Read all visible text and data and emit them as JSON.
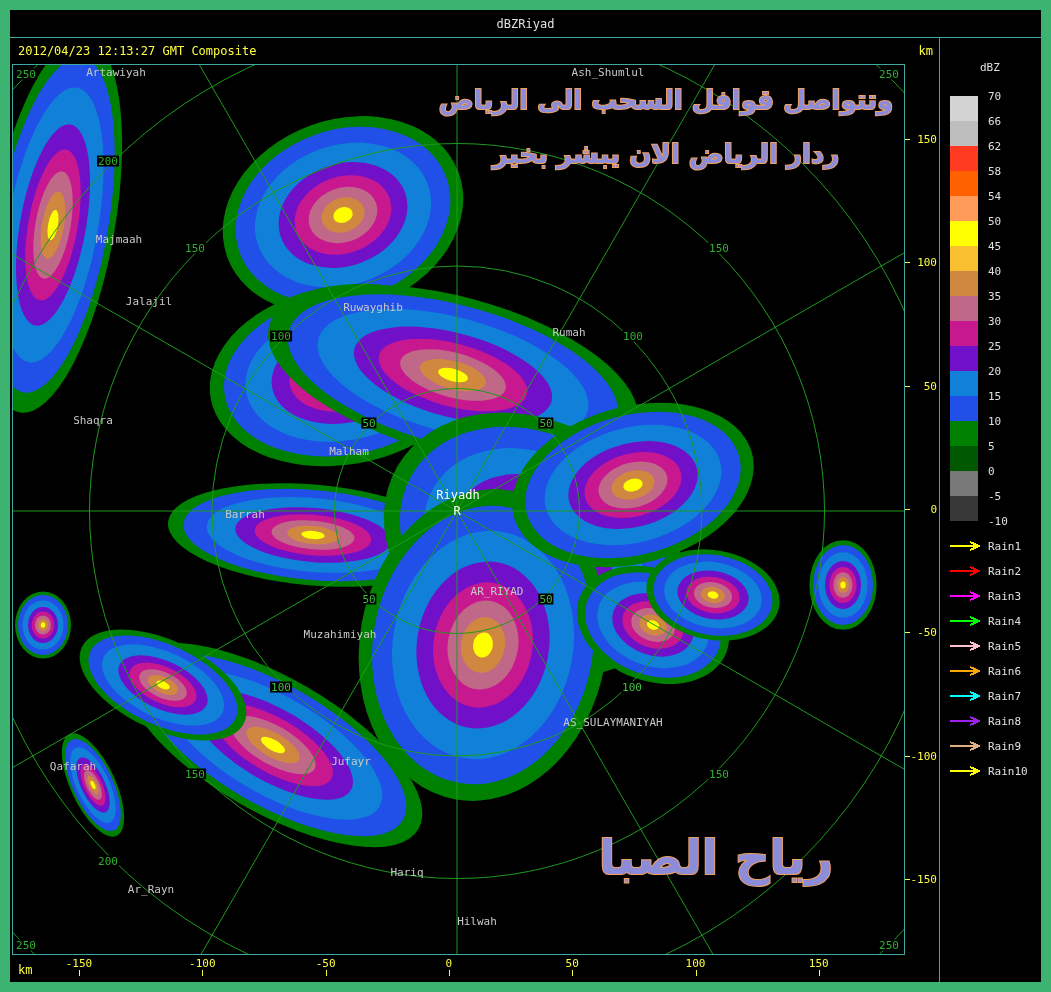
{
  "window": {
    "title": "dBZRiyad"
  },
  "header": {
    "timestamp": "2012/04/23 12:13:27 GMT Composite",
    "unit": "km"
  },
  "map": {
    "range_labels": [
      {
        "label": "250",
        "kind": "plain"
      },
      {
        "label": "250",
        "kind": "plain"
      },
      {
        "label": "200",
        "kind": "plain"
      },
      {
        "label": "150",
        "kind": "plain"
      },
      {
        "label": "150",
        "kind": "plain"
      },
      {
        "label": "100",
        "kind": "plain"
      },
      {
        "label": "100",
        "kind": "plain"
      },
      {
        "label": "50",
        "kind": "boxed"
      },
      {
        "label": "50",
        "kind": "boxed"
      },
      {
        "label": "50",
        "kind": "boxed"
      },
      {
        "label": "50",
        "kind": "boxed"
      },
      {
        "label": "100",
        "kind": "boxed"
      },
      {
        "label": "100",
        "kind": "boxed"
      },
      {
        "label": "150",
        "kind": "plain"
      },
      {
        "label": "150",
        "kind": "plain"
      },
      {
        "label": "200",
        "kind": "plain"
      },
      {
        "label": "250",
        "kind": "plain"
      },
      {
        "label": "250",
        "kind": "plain"
      }
    ],
    "places": [
      {
        "label": "Artawiyah",
        "kind": "town"
      },
      {
        "label": "Ash_Shumlul",
        "kind": "town"
      },
      {
        "label": "Majmaah",
        "kind": "town"
      },
      {
        "label": "Jalajil",
        "kind": "town"
      },
      {
        "label": "Ruwayghib",
        "kind": "town"
      },
      {
        "label": "Rumah",
        "kind": "town"
      },
      {
        "label": "Shaqra",
        "kind": "town"
      },
      {
        "label": "Malham",
        "kind": "town"
      },
      {
        "label": "Barrah",
        "kind": "town"
      },
      {
        "label": "Riyadh",
        "kind": "radar"
      },
      {
        "label": "R",
        "kind": "radar"
      },
      {
        "label": "AR_RIYAD",
        "kind": "town"
      },
      {
        "label": "Muzahimiyah",
        "kind": "town"
      },
      {
        "label": "AS_SULAYMANIYAH",
        "kind": "town"
      },
      {
        "label": "Qafarah",
        "kind": "town"
      },
      {
        "label": "Jufayr",
        "kind": "town"
      },
      {
        "label": "Hariq",
        "kind": "town"
      },
      {
        "label": "Ar_Rayn",
        "kind": "town"
      },
      {
        "label": "Hilwah",
        "kind": "town"
      }
    ],
    "captions": [
      "وتتواصل قوافل السحب الى الرياض",
      "ردار الرياض الان يبشر بخير",
      "رياح الصبا"
    ]
  },
  "y_axis": {
    "ticks": [
      "150",
      "100",
      "50",
      "0",
      "-50",
      "-100",
      "-150"
    ]
  },
  "x_axis": {
    "unit": "km",
    "ticks": [
      "-150",
      "-100",
      "-50",
      "0",
      "50",
      "100",
      "150"
    ]
  },
  "legend": {
    "title": "dBZ",
    "bins": [
      {
        "color": "#d3d3d3"
      },
      {
        "color": "#bebebe"
      },
      {
        "color": "#ff3a20"
      },
      {
        "color": "#ff6000"
      },
      {
        "color": "#ff9a58"
      },
      {
        "color": "#ffff00"
      },
      {
        "color": "#f8c030"
      },
      {
        "color": "#d08840"
      },
      {
        "color": "#c06888"
      },
      {
        "color": "#c81890"
      },
      {
        "color": "#7010c8"
      },
      {
        "color": "#1080d8"
      },
      {
        "color": "#2050e8"
      },
      {
        "color": "#008000"
      },
      {
        "color": "#005800"
      },
      {
        "color": "#787878"
      },
      {
        "color": "#383838"
      }
    ],
    "edges": [
      "70",
      "66",
      "62",
      "58",
      "54",
      "50",
      "45",
      "40",
      "35",
      "30",
      "25",
      "20",
      "15",
      "10",
      "5",
      "0",
      "-5",
      "-10"
    ],
    "tracks": [
      {
        "label": "Rain1",
        "color": "#ffff00"
      },
      {
        "label": "Rain2",
        "color": "#ff0000"
      },
      {
        "label": "Rain3",
        "color": "#ff00ff"
      },
      {
        "label": "Rain4",
        "color": "#00ff00"
      },
      {
        "label": "Rain5",
        "color": "#ffc0cb"
      },
      {
        "label": "Rain6",
        "color": "#ffa500"
      },
      {
        "label": "Rain7",
        "color": "#00ffff"
      },
      {
        "label": "Rain8",
        "color": "#a020f0"
      },
      {
        "label": "Rain9",
        "color": "#e0b080"
      },
      {
        "label": "Rain10",
        "color": "#ffff00"
      }
    ]
  }
}
